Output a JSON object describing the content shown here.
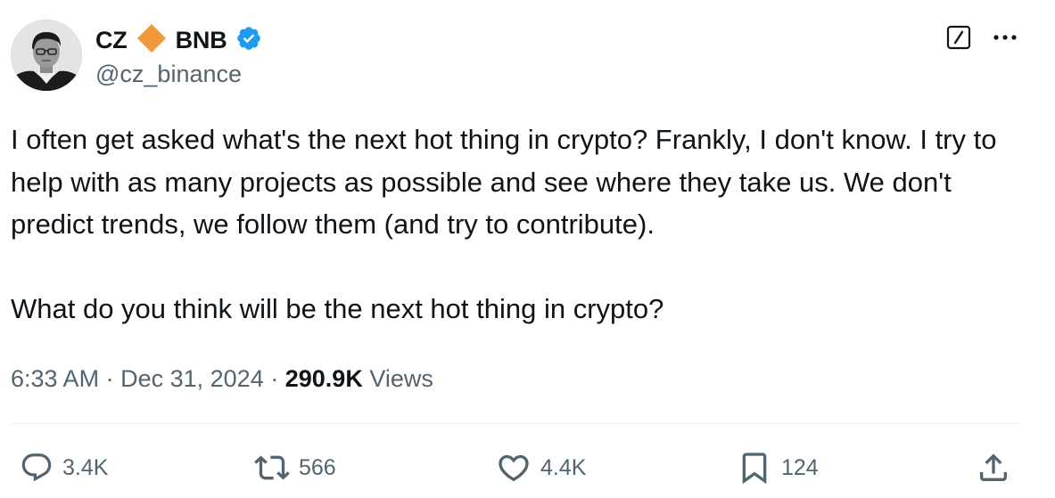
{
  "author": {
    "display_name_part1": "CZ",
    "display_name_part2": "BNB",
    "handle": "@cz_binance",
    "diamond_color": "#F0983A",
    "verified_color": "#1D9BF0"
  },
  "tweet": {
    "paragraphs": [
      "I often get asked what's the next hot thing in crypto? Frankly, I don't know. I try to help with as many projects as possible and see where they take us. We don't predict trends, we follow them (and try to contribute).",
      "What do you think will be the next hot thing in crypto?"
    ]
  },
  "meta": {
    "time": "6:33 AM",
    "separator": "·",
    "date": "Dec 31, 2024",
    "views_count": "290.9K",
    "views_label": "Views"
  },
  "actions": {
    "replies": "3.4K",
    "reposts": "566",
    "likes": "4.4K",
    "bookmarks": "124"
  },
  "icons": {
    "reply": "reply-icon",
    "repost": "repost-icon",
    "like": "heart-icon",
    "bookmark": "bookmark-icon",
    "share": "share-icon",
    "grok": "grok-icon",
    "more": "more-icon",
    "verified": "verified-badge-icon"
  }
}
